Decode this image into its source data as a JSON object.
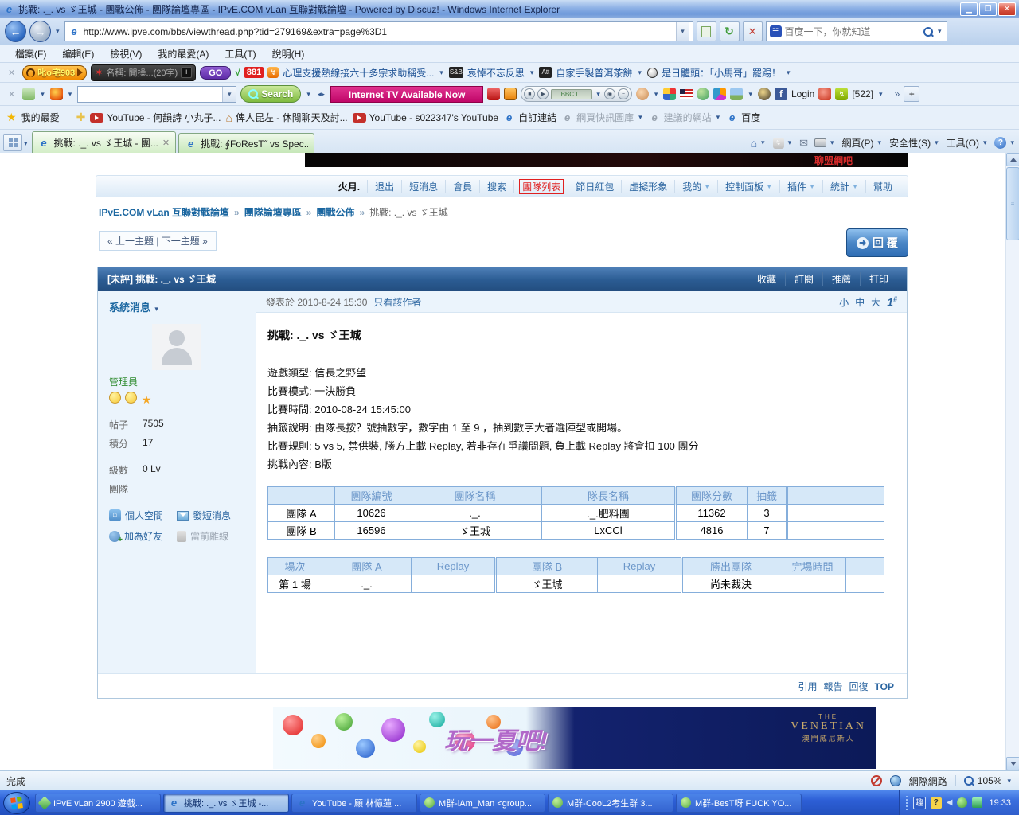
{
  "window": {
    "title": "挑戰: ._. vs ゞ王城 - 團戰公佈 - 團隊論壇專區 - IPvE.COM vLan 互聯對戰論壇 - Powered by Discuz! - Windows Internet Explorer"
  },
  "browser": {
    "url": "http://www.ipve.com/bbs/viewthread.php?tid=279169&extra=page%3D1",
    "search_placeholder": "百度一下，你就知道",
    "menu_items": [
      "檔案(F)",
      "編輯(E)",
      "檢視(V)",
      "我的最愛(A)",
      "工具(T)",
      "說明(H)"
    ],
    "addon1": {
      "radio": "叱o宅903",
      "name_box": "名稱: 開操...(20字)",
      "go": "GO",
      "badge": "881",
      "headline1": "心理支援熱線接六十多宗求助稱受...",
      "icon2": "S&B",
      "headline2": "哀悼不忘反思",
      "icon3": "Att",
      "headline3": "自家手製普洱茶餅",
      "headline4": "是日體頭：「小馬哥」罷踢！"
    },
    "addon2": {
      "search": "Search",
      "tv": "Internet TV Available Now",
      "player": "BBC I...",
      "fb_login": "Login",
      "rss_count": "[522]"
    },
    "favorites": {
      "label": "我的最愛",
      "items": [
        "YouTube - 何韻詩 小丸子...",
        "俾人昆左 - 休閒聊天及討...",
        "YouTube - s022347's YouTube",
        "自訂連結",
        "網頁快訊圖庫",
        "建議的網站",
        "百度"
      ]
    },
    "tabs": [
      "挑戰: ._. vs ゞ王城 - 團...",
      "挑戰: ∮FoResT˝ vs Spec...."
    ],
    "commands": [
      "網頁(P)",
      "安全性(S)",
      "工具(O)"
    ]
  },
  "page": {
    "banner_text": "聊盟網吧",
    "nav": {
      "user": "火月.",
      "logout": "退出",
      "msg": "短消息",
      "members": "會員",
      "search": "搜索",
      "teams": "團隊列表",
      "redpacket": "節日紅包",
      "avatar": "虛擬形象",
      "mine": "我的",
      "panel": "控制面板",
      "plugins": "插件",
      "stats": "統計",
      "help": "幫助"
    },
    "breadcrumb": {
      "root": "IPvE.COM vLan 互聯對戰論壇",
      "forum": "團隊論壇專區",
      "sub": "團戰公佈",
      "current": "挑戰: ._. vs ゞ王城",
      "sep": "»"
    },
    "topic_nav": "« 上一主題 | 下一主題 »",
    "reply": "回 覆",
    "thread": {
      "title": "[未評] 挑戰: ._. vs ゞ王城",
      "actions": [
        "收藏",
        "訂閱",
        "推薦",
        "打印"
      ],
      "author": {
        "name": "系統消息",
        "role": "管理員",
        "stats": [
          [
            "帖子",
            "7505"
          ],
          [
            "積分",
            "17"
          ],
          [
            "級數",
            "0 Lv"
          ],
          [
            "團隊",
            ""
          ]
        ],
        "links": [
          "個人空間",
          "發短消息",
          "加為好友"
        ],
        "offline": "當前離線"
      },
      "meta": {
        "posted": "發表於 2010-8-24 15:30",
        "only": "只看該作者",
        "sizes": [
          "小",
          "中",
          "大"
        ],
        "floor": "1",
        "floor_mark": "#"
      },
      "post_title": "挑戰: ._. vs ゞ王城",
      "post_lines": [
        "遊戲類型: 信長之野望",
        "比賽模式: 一決勝負",
        "比賽時間: 2010-08-24 15:45:00",
        "抽籤說明: 由隊長按？號抽數字，數字由 1 至 9 ，抽到數字大者選陣型或開場。",
        "比賽規則: 5 vs 5, 禁供裝, 勝方上載 Replay, 若非存在爭議問題, 負上載 Replay 將會扣 100 團分",
        "挑戰內容: B版"
      ],
      "team_table": {
        "headers": [
          "",
          "團隊編號",
          "團隊名稱",
          "隊長名稱",
          "團隊分數",
          "抽籤",
          ""
        ],
        "rows": [
          [
            "團隊 A",
            "10626",
            "._.",
            "._.肥料團",
            "11362",
            "3",
            ""
          ],
          [
            "團隊 B",
            "16596",
            "ゞ王城",
            "LxCCl",
            "4816",
            "7",
            ""
          ]
        ]
      },
      "match_table": {
        "headers": [
          "場次",
          "團隊 A",
          "Replay",
          "團隊 B",
          "Replay",
          "勝出團隊",
          "完場時間",
          ""
        ],
        "rows": [
          [
            "第 1 場",
            "._.",
            "",
            "ゞ王城",
            "",
            "尚未裁決",
            "",
            ""
          ]
        ]
      },
      "footer": [
        "引用",
        "報告",
        "回復",
        "TOP"
      ]
    },
    "ad": {
      "slogan": "玩一夏吧!",
      "the": "THE",
      "brand": "VENETIAN",
      "cn": "澳門威尼斯人"
    }
  },
  "status": {
    "done": "完成",
    "zone": "網際網路",
    "zoom": "105%"
  },
  "taskbar": {
    "tasks": [
      "IPvE vLan 2900 遊戲...",
      "挑戰: ._. vs ゞ王城 -...",
      "YouTube - 願 林憶蓮 ...",
      "M群-iAm_Man <group...",
      "M群-CooL2考生群 3...",
      "M群-BesT呀 FUCK YO..."
    ],
    "time": "19:33"
  },
  "colors": {
    "accent_blue": "#2B5C93",
    "link": "#2B65A0",
    "alert_red": "#E02020",
    "lose_red": "#943634",
    "tab_green": "#D4EEC8"
  }
}
